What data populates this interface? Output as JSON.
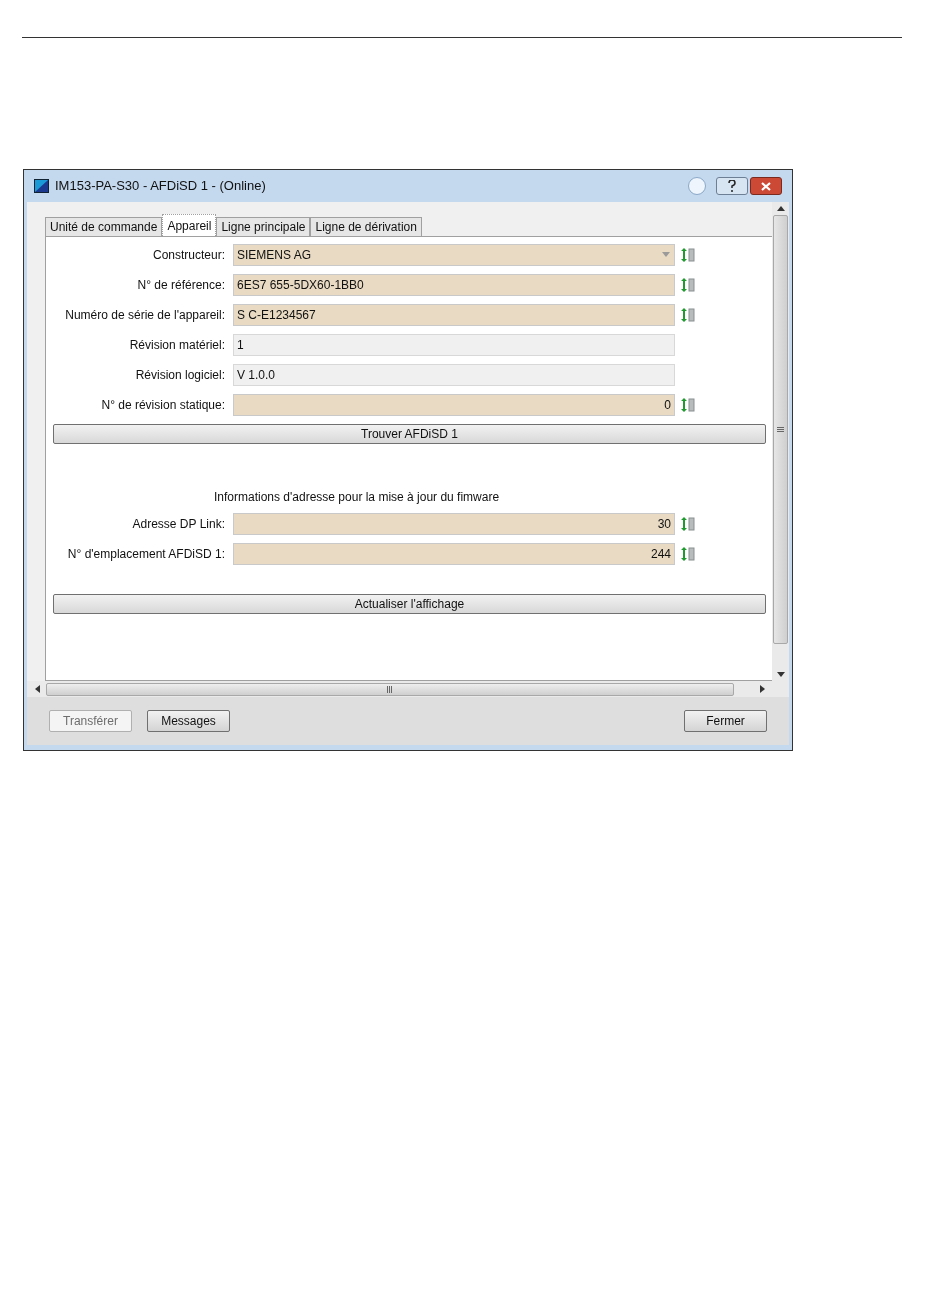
{
  "window": {
    "title": "IM153-PA-S30 - AFDiSD 1 - (Online)"
  },
  "tabs": [
    {
      "label": "Unité de commande",
      "selected": false
    },
    {
      "label": "Appareil",
      "selected": true
    },
    {
      "label": "Ligne principale",
      "selected": false
    },
    {
      "label": "Ligne de dérivation",
      "selected": false
    }
  ],
  "device_fields": [
    {
      "label": "Constructeur:",
      "value": "SIEMENS AG",
      "kind": "combo",
      "editable": true
    },
    {
      "label": "N° de référence:",
      "value": "6ES7 655-5DX60-1BB0",
      "kind": "text",
      "editable": true
    },
    {
      "label": "Numéro de série de l'appareil:",
      "value": "S C-E1234567",
      "kind": "text",
      "editable": true
    },
    {
      "label": "Révision matériel:",
      "value": "1",
      "kind": "text",
      "editable": false
    },
    {
      "label": "Révision logiciel:",
      "value": "V 1.0.0",
      "kind": "text",
      "editable": false
    },
    {
      "label": "N° de révision statique:",
      "value": "0",
      "kind": "number",
      "editable": true
    }
  ],
  "find_button": "Trouver AFDiSD 1",
  "address_heading": "Informations d'adresse pour la mise à jour du fimware",
  "address_fields": [
    {
      "label": "Adresse DP Link:",
      "value": "30",
      "kind": "number",
      "editable": true
    },
    {
      "label": "N° d'emplacement AFDiSD 1:",
      "value": "244",
      "kind": "number",
      "editable": true
    }
  ],
  "refresh_button": "Actualiser l'affichage",
  "footer_buttons": [
    {
      "label": "Transférer",
      "disabled": true
    },
    {
      "label": "Messages",
      "disabled": false
    }
  ],
  "close_button": "Fermer"
}
